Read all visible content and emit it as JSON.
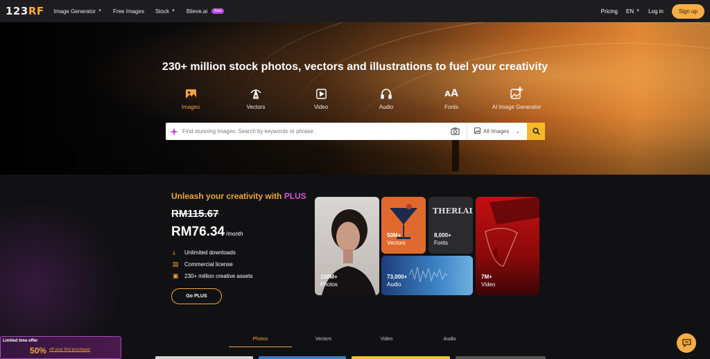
{
  "nav": {
    "logo_a": "123",
    "logo_b": "RF",
    "items": [
      {
        "label": "Image Generator",
        "has_dropdown": true
      },
      {
        "label": "Free Images",
        "has_dropdown": false
      },
      {
        "label": "Stock",
        "has_dropdown": true
      },
      {
        "label": "Blieve.ai",
        "badge": "Beta"
      }
    ],
    "pricing": "Pricing",
    "language": "EN",
    "login": "Log in",
    "signup": "Sign up"
  },
  "hero": {
    "title": "230+ million stock photos, vectors and illustrations to fuel your creativity",
    "categories": [
      {
        "label": "Images",
        "icon": "image-icon",
        "active": true
      },
      {
        "label": "Vectors",
        "icon": "pen-tool-icon",
        "active": false
      },
      {
        "label": "Video",
        "icon": "play-icon",
        "active": false
      },
      {
        "label": "Audio",
        "icon": "headphones-icon",
        "active": false
      },
      {
        "label": "Fonts",
        "icon": "font-icon",
        "active": false
      },
      {
        "label": "AI Image Generator",
        "icon": "ai-image-icon",
        "active": false
      }
    ],
    "search": {
      "placeholder": "Find stunning images. Search by keywords or phrase.",
      "type": "All Images"
    }
  },
  "plus": {
    "title_prefix": "Unleash your creativity with ",
    "title_brand": "PLUS",
    "old_price": "RM115.67",
    "price": "RM76.34",
    "period": "/month",
    "features": [
      "Unlimited downloads",
      "Commercial license",
      "230+ million creative assets"
    ],
    "button": "Go PLUS",
    "tiles": [
      {
        "count": "150M+",
        "label": "Photos"
      },
      {
        "count": "50M+",
        "label": "Vectors"
      },
      {
        "count": "8,000+",
        "label": "Fonts",
        "art_text": "THERLALU"
      },
      {
        "count": "73,000+",
        "label": "Audio"
      },
      {
        "count": "7M+",
        "label": "Video"
      }
    ]
  },
  "tabs": [
    {
      "label": "Photos",
      "active": true
    },
    {
      "label": "Vectors",
      "active": false
    },
    {
      "label": "Video",
      "active": false
    },
    {
      "label": "Audio",
      "active": false
    }
  ],
  "offer": {
    "label": "Limited time offer",
    "percent": "50%",
    "text": "off your first purchase!"
  },
  "colors": {
    "accent": "#f5ad47",
    "brand_purple": "#b44be1"
  }
}
